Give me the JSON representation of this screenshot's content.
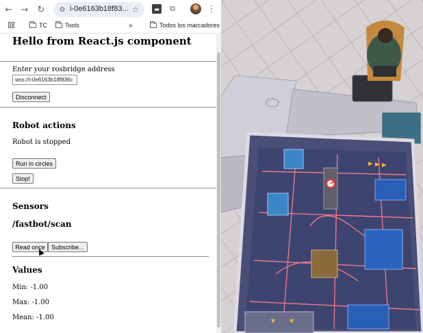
{
  "browser": {
    "url": "i-0e6163b18f83...",
    "bookmarks": [
      {
        "label": "TC"
      },
      {
        "label": "Tools"
      },
      {
        "label": "Todos los marcadores"
      }
    ],
    "overflow_glyph": "»"
  },
  "page": {
    "title": "Hello from React.js component",
    "rosbridge": {
      "label": "Enter your rosbridge address",
      "value": "wss://i-0e6163b18f836c",
      "disconnect_label": "Disconnect"
    },
    "robot_actions": {
      "heading": "Robot actions",
      "status": "Robot is stopped",
      "run_label": "Run in circles",
      "stop_label": "Stop!"
    },
    "sensors": {
      "heading": "Sensors",
      "topic": "/fastbot/scan",
      "read_once_label": "Read once",
      "subscribe_label": "Subscribe..."
    },
    "values": {
      "heading": "Values",
      "min": "Min: -1.00",
      "max": "Max: -1.00",
      "mean": "Mean: -1.00"
    }
  },
  "icons": [
    "back-icon",
    "forward-icon",
    "reload-icon",
    "site-info-icon",
    "star-icon",
    "extension-icon",
    "puzzle-icon",
    "avatar",
    "menu-icon",
    "apps-icon",
    "folder-icon"
  ]
}
